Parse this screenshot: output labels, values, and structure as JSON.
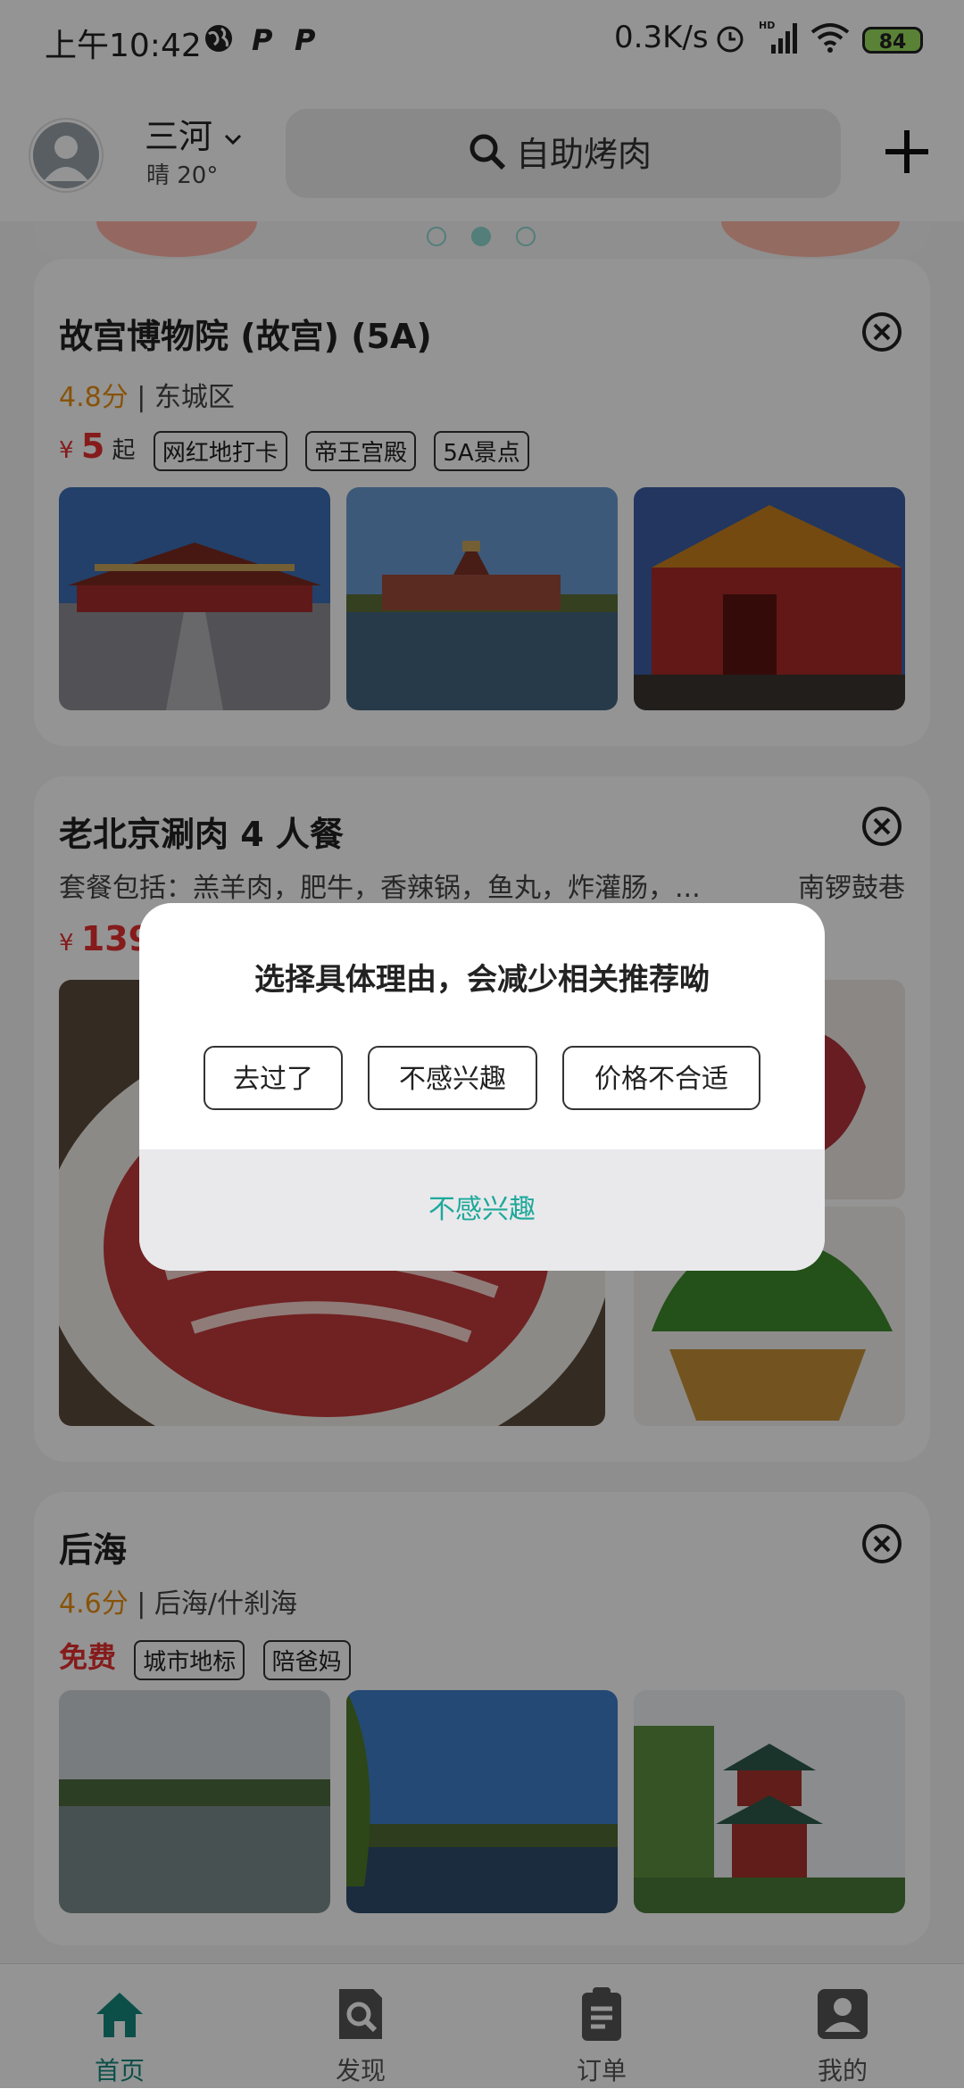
{
  "status_bar": {
    "time": "上午10:42",
    "speed": "0.3K/s",
    "battery": "84",
    "hd": "HD"
  },
  "header": {
    "city": "三河",
    "weather": "晴 20°",
    "search_placeholder": "自助烤肉"
  },
  "cards": [
    {
      "title": "故宫博物院 (故宫) (5A)",
      "score": "4.8分",
      "district": "| 东城区",
      "price_symbol": "¥",
      "price": "5",
      "price_suffix": "起",
      "tags": [
        "网红地打卡",
        "帝王宫殿",
        "5A景点"
      ]
    },
    {
      "title": "老北京涮肉 4 人餐",
      "desc": "套餐包括：羔羊肉，肥牛，香辣锅，鱼丸，炸灌肠，...",
      "location": "南锣鼓巷",
      "price_symbol": "¥",
      "price": "139"
    },
    {
      "title": "后海",
      "score": "4.6分",
      "district": "| 后海/什刹海",
      "price_text": "免费",
      "tags": [
        "城市地标",
        "陪爸妈"
      ]
    }
  ],
  "dialog": {
    "title": "选择具体理由，会减少相关推荐呦",
    "reasons": [
      "去过了",
      "不感兴趣",
      "价格不合适"
    ],
    "footer": "不感兴趣"
  },
  "nav": [
    {
      "label": "首页",
      "icon": "home-icon",
      "active": true
    },
    {
      "label": "发现",
      "icon": "discover-icon",
      "active": false
    },
    {
      "label": "订单",
      "icon": "order-icon",
      "active": false
    },
    {
      "label": "我的",
      "icon": "profile-icon",
      "active": false
    }
  ],
  "colors": {
    "accent": "#1ea89a",
    "price": "#e53030",
    "score": "#e89010",
    "nav_active": "#15887e"
  }
}
